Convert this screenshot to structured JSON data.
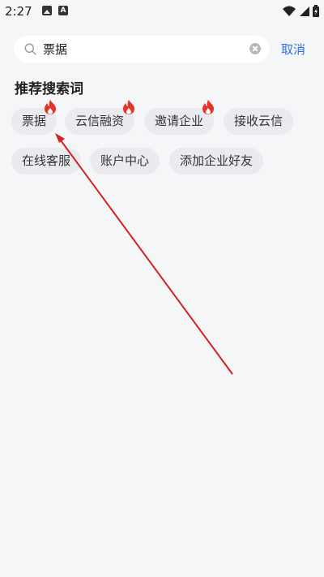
{
  "status_bar": {
    "time": "2:27"
  },
  "search": {
    "value": "票据"
  },
  "cancel_label": "取消",
  "section_title": "推荐搜索词",
  "chips": [
    {
      "label": "票据",
      "hot": true
    },
    {
      "label": "云信融资",
      "hot": true
    },
    {
      "label": "邀请企业",
      "hot": true
    },
    {
      "label": "接收云信",
      "hot": false
    },
    {
      "label": "在线客服",
      "hot": false
    },
    {
      "label": "账户中心",
      "hot": false
    },
    {
      "label": "添加企业好友",
      "hot": false
    }
  ],
  "colors": {
    "accent": "#2f6fe0",
    "chip_bg": "#e9ebee",
    "hot": "#e8332a",
    "annotation": "#d62121"
  }
}
